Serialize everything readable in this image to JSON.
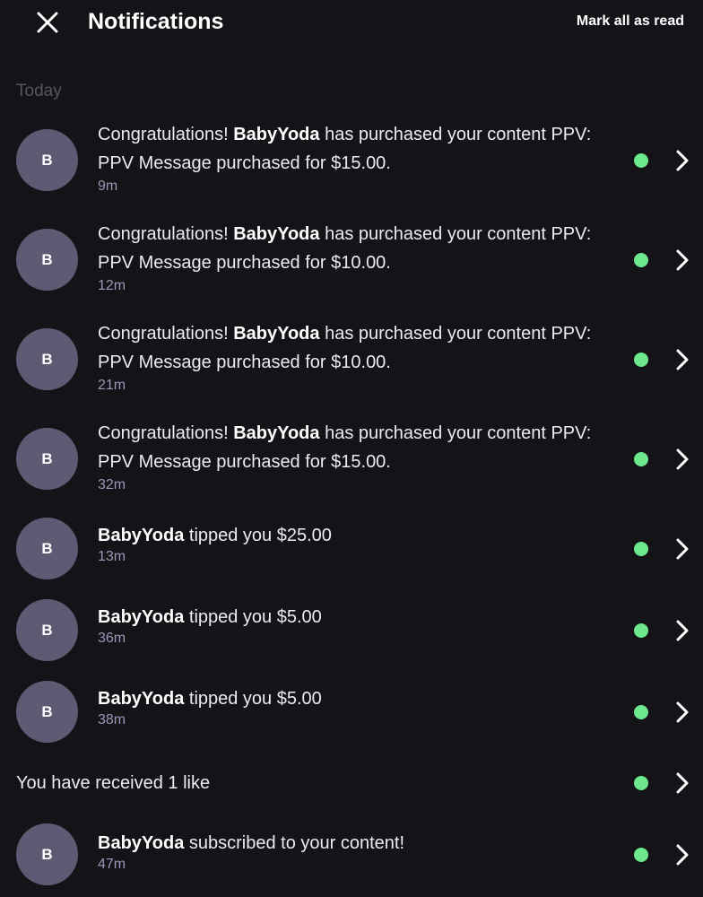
{
  "header": {
    "title": "Notifications",
    "mark_all_label": "Mark all as read",
    "close_icon": "close-icon"
  },
  "section": {
    "label": "Today"
  },
  "colors": {
    "background": "#141418",
    "avatar": "#5d5a74",
    "unread_dot": "#6ee88d",
    "timestamp": "#9a97b8"
  },
  "notifications": [
    {
      "avatar": "B",
      "prefix": "Congratulations! ",
      "user": "BabyYoda",
      "text": " has purchased your content PPV: PPV Message purchased for $15.00.",
      "time": "9m",
      "unread": true
    },
    {
      "avatar": "B",
      "prefix": "Congratulations! ",
      "user": "BabyYoda",
      "text": " has purchased your content PPV: PPV Message purchased for $10.00.",
      "time": "12m",
      "unread": true
    },
    {
      "avatar": "B",
      "prefix": "Congratulations! ",
      "user": "BabyYoda",
      "text": " has purchased your content PPV: PPV Message purchased for $10.00.",
      "time": "21m",
      "unread": true
    },
    {
      "avatar": "B",
      "prefix": "Congratulations! ",
      "user": "BabyYoda",
      "text": " has purchased your content PPV: PPV Message purchased for $15.00.",
      "time": "32m",
      "unread": true
    },
    {
      "avatar": "B",
      "prefix": "",
      "user": "BabyYoda",
      "text": " tipped you $25.00",
      "time": "13m",
      "unread": true
    },
    {
      "avatar": "B",
      "prefix": "",
      "user": "BabyYoda",
      "text": " tipped you $5.00",
      "time": "36m",
      "unread": true
    },
    {
      "avatar": "B",
      "prefix": "",
      "user": "BabyYoda",
      "text": " tipped you $5.00",
      "time": "38m",
      "unread": true
    },
    {
      "avatar": "",
      "prefix": "",
      "user": "",
      "text": "You have received 1 like",
      "time": "",
      "unread": true
    },
    {
      "avatar": "B",
      "prefix": "",
      "user": "BabyYoda",
      "text": " subscribed to your content!",
      "time": "47m",
      "unread": true
    }
  ]
}
